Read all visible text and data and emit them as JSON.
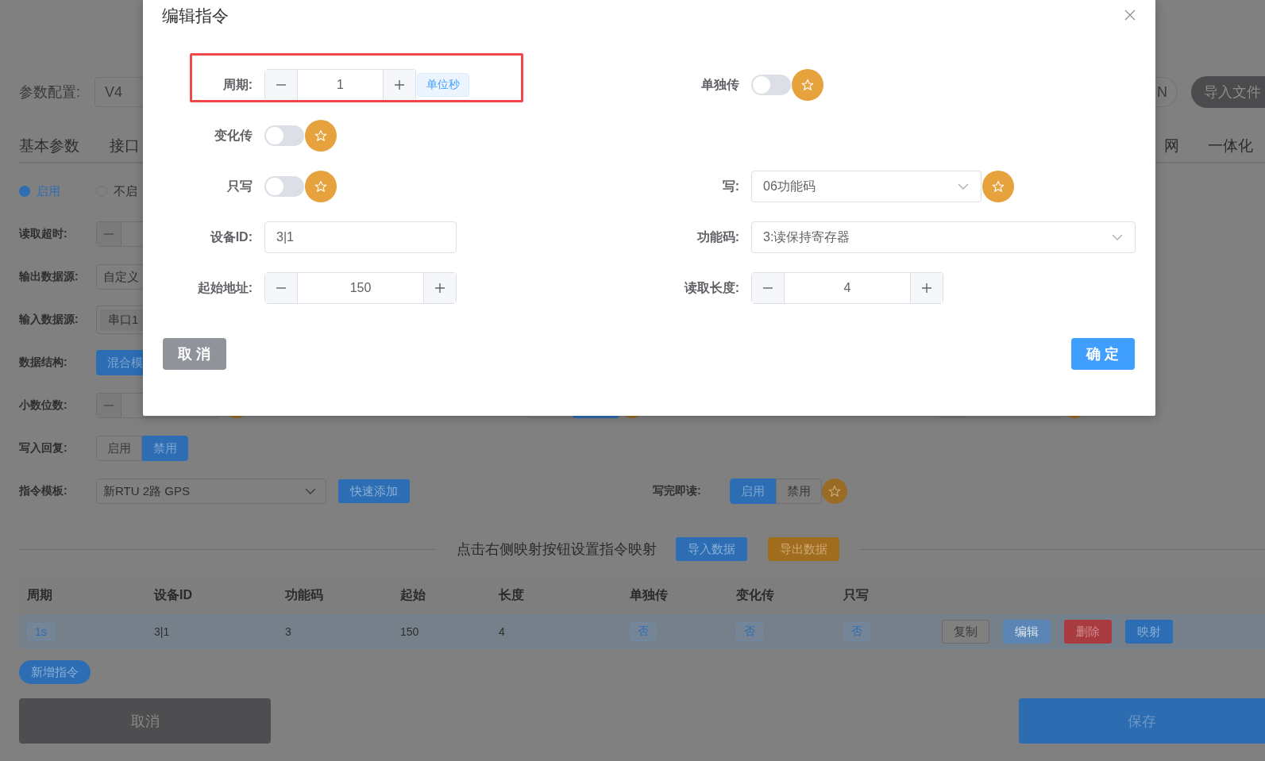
{
  "page": {
    "config_label": "参数配置:",
    "config_value": "V4",
    "outline_button": "N",
    "import_file_button": "导入文件"
  },
  "tabs_left": [
    "基本参数",
    "接口"
  ],
  "tabs_right": [
    "网",
    "一体化"
  ],
  "enable_radios": [
    {
      "label": "启用",
      "selected": true
    },
    {
      "label": "不启",
      "selected": false
    }
  ],
  "settings": [
    {
      "label": "读取超时:",
      "kind": "stepper"
    },
    {
      "label": "输出数据源:",
      "kind": "select",
      "value": "自定义"
    },
    {
      "label": "输入数据源:",
      "kind": "tags",
      "value": "串口1"
    },
    {
      "label": "数据结构:",
      "kind": "button",
      "value": "混合模"
    },
    {
      "label": "小数位数:",
      "kind": "stepper"
    },
    {
      "label": "写入回复:",
      "kind": "segmented",
      "options": [
        {
          "label": "启用",
          "selected": false
        },
        {
          "label": "禁用",
          "selected": true
        }
      ]
    }
  ],
  "template": {
    "label": "指令模板:",
    "value": "新RTU 2路 GPS",
    "button": "快速添加"
  },
  "write_then_read": {
    "label": "写完即读:",
    "options": [
      {
        "label": "启用",
        "selected": true
      },
      {
        "label": "禁用",
        "selected": false
      }
    ]
  },
  "mapping": {
    "hint": "点击右侧映射按钮设置指令映射",
    "import_button": "导入数据",
    "export_button": "导出数据"
  },
  "table": {
    "columns": [
      "周期",
      "设备ID",
      "功能码",
      "起始",
      "长度",
      "单独传",
      "变化传",
      "只写"
    ],
    "rows": [
      {
        "cells": [
          {
            "text": "1s",
            "kind": "tag"
          },
          {
            "text": "3|1",
            "kind": "text"
          },
          {
            "text": "3",
            "kind": "text"
          },
          {
            "text": "150",
            "kind": "text"
          },
          {
            "text": "4",
            "kind": "text"
          },
          {
            "text": "否",
            "kind": "tag"
          },
          {
            "text": "否",
            "kind": "tag"
          },
          {
            "text": "否",
            "kind": "tag"
          }
        ],
        "actions": [
          {
            "label": "复制",
            "kind": "default"
          },
          {
            "label": "编辑",
            "kind": "info"
          },
          {
            "label": "删除",
            "kind": "danger"
          },
          {
            "label": "映射",
            "kind": "primary"
          }
        ]
      }
    ]
  },
  "add_button": "新增指令",
  "footer": {
    "cancel": "取消",
    "save": "保存"
  },
  "dialog": {
    "title": "编辑指令",
    "rows": [
      {
        "left": {
          "label": "周期:",
          "kind": "stepper",
          "value": "1",
          "unit": "单位秒",
          "highlighted": true
        },
        "right": {
          "label": "单独传",
          "kind": "switch",
          "on": false,
          "starred": true
        }
      },
      {
        "left": {
          "label": "变化传",
          "kind": "switch",
          "on": false,
          "starred": true
        }
      },
      {
        "left": {
          "label": "只写",
          "kind": "switch",
          "on": false,
          "starred": true
        },
        "right": {
          "label": "写:",
          "kind": "select",
          "value": "06功能码",
          "starred": true
        }
      },
      {
        "left": {
          "label": "设备ID:",
          "kind": "input",
          "value": "3|1"
        },
        "right": {
          "label": "功能码:",
          "kind": "select",
          "value": "3:读保持寄存器"
        }
      },
      {
        "left": {
          "label": "起始地址:",
          "kind": "stepper",
          "value": "150"
        },
        "right": {
          "label": "读取长度:",
          "kind": "stepper",
          "value": "4"
        }
      }
    ],
    "cancel": "取 消",
    "confirm": "确 定"
  }
}
